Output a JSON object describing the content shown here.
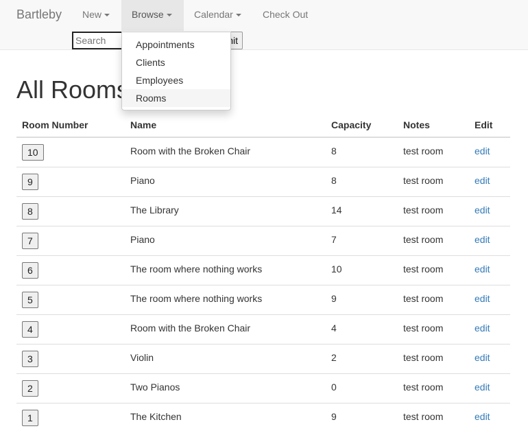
{
  "nav": {
    "brand": "Bartleby",
    "items": [
      {
        "label": "New"
      },
      {
        "label": "Browse"
      },
      {
        "label": "Calendar"
      },
      {
        "label": "Check Out"
      }
    ],
    "search_placeholder": "Search",
    "submit_label": "Submit"
  },
  "dropdown": {
    "items": [
      "Appointments",
      "Clients",
      "Employees",
      "Rooms"
    ]
  },
  "page": {
    "title": "All Rooms"
  },
  "table": {
    "headers": [
      "Room Number",
      "Name",
      "Capacity",
      "Notes",
      "Edit"
    ],
    "rows": [
      {
        "number": "10",
        "name": "Room with the Broken Chair",
        "capacity": "8",
        "notes": "test room",
        "edit": "edit"
      },
      {
        "number": "9",
        "name": "Piano",
        "capacity": "8",
        "notes": "test room",
        "edit": "edit"
      },
      {
        "number": "8",
        "name": "The Library",
        "capacity": "14",
        "notes": "test room",
        "edit": "edit"
      },
      {
        "number": "7",
        "name": "Piano",
        "capacity": "7",
        "notes": "test room",
        "edit": "edit"
      },
      {
        "number": "6",
        "name": "The room where nothing works",
        "capacity": "10",
        "notes": "test room",
        "edit": "edit"
      },
      {
        "number": "5",
        "name": "The room where nothing works",
        "capacity": "9",
        "notes": "test room",
        "edit": "edit"
      },
      {
        "number": "4",
        "name": "Room with the Broken Chair",
        "capacity": "4",
        "notes": "test room",
        "edit": "edit"
      },
      {
        "number": "3",
        "name": "Violin",
        "capacity": "2",
        "notes": "test room",
        "edit": "edit"
      },
      {
        "number": "2",
        "name": "Two Pianos",
        "capacity": "0",
        "notes": "test room",
        "edit": "edit"
      },
      {
        "number": "1",
        "name": "The Kitchen",
        "capacity": "9",
        "notes": "test room",
        "edit": "edit"
      }
    ]
  },
  "colors": {
    "link": "#337ab7",
    "navbar": "#f8f8f8"
  }
}
